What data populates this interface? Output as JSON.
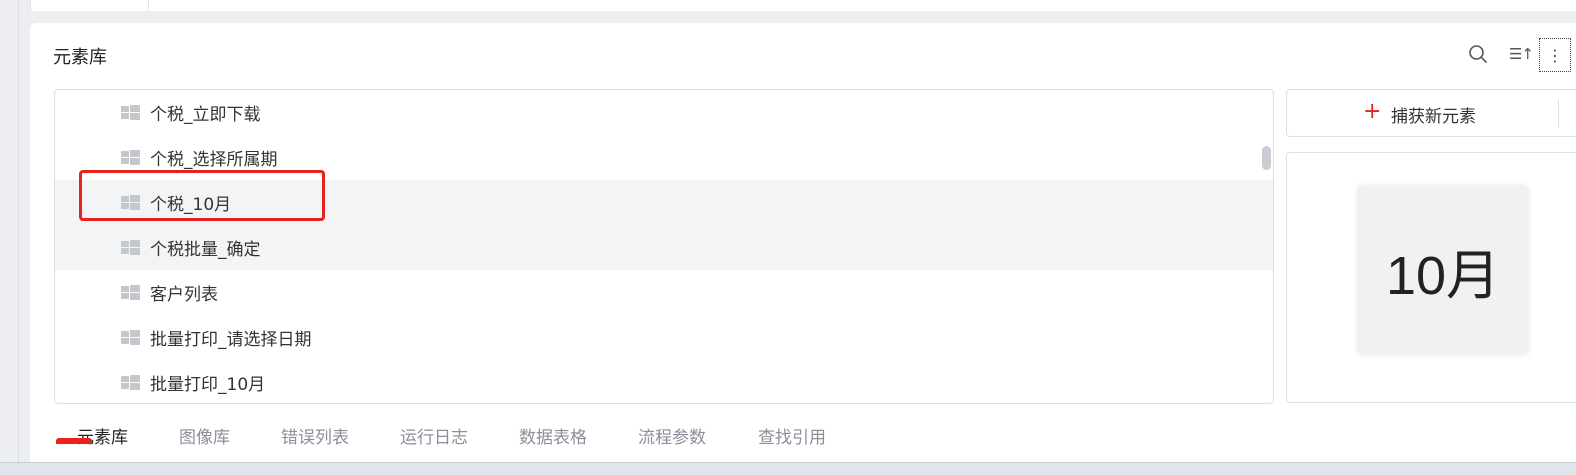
{
  "panel": {
    "title": "元素库"
  },
  "toolbar": {
    "search_icon": "search-icon",
    "sort_icon_text": "☰↑",
    "more_icon_text": "⋮"
  },
  "elements": [
    {
      "label": "个税_立即下载"
    },
    {
      "label": "个税_选择所属期"
    },
    {
      "label": "个税_10月",
      "selected": true
    },
    {
      "label": "个税批量_确定"
    },
    {
      "label": "客户列表"
    },
    {
      "label": "批量打印_请选择日期"
    },
    {
      "label": "批量打印_10月"
    }
  ],
  "capture": {
    "plus": "+",
    "label": "捕获新元素"
  },
  "preview": {
    "text": "10月"
  },
  "tabs": [
    {
      "label": "元素库",
      "active": true
    },
    {
      "label": "图像库"
    },
    {
      "label": "错误列表"
    },
    {
      "label": "运行日志"
    },
    {
      "label": "数据表格"
    },
    {
      "label": "流程参数"
    },
    {
      "label": "查找引用"
    }
  ],
  "colors": {
    "accent": "#e8231f",
    "selected_row": "#f3f4f6",
    "border": "#dcdfe6"
  }
}
